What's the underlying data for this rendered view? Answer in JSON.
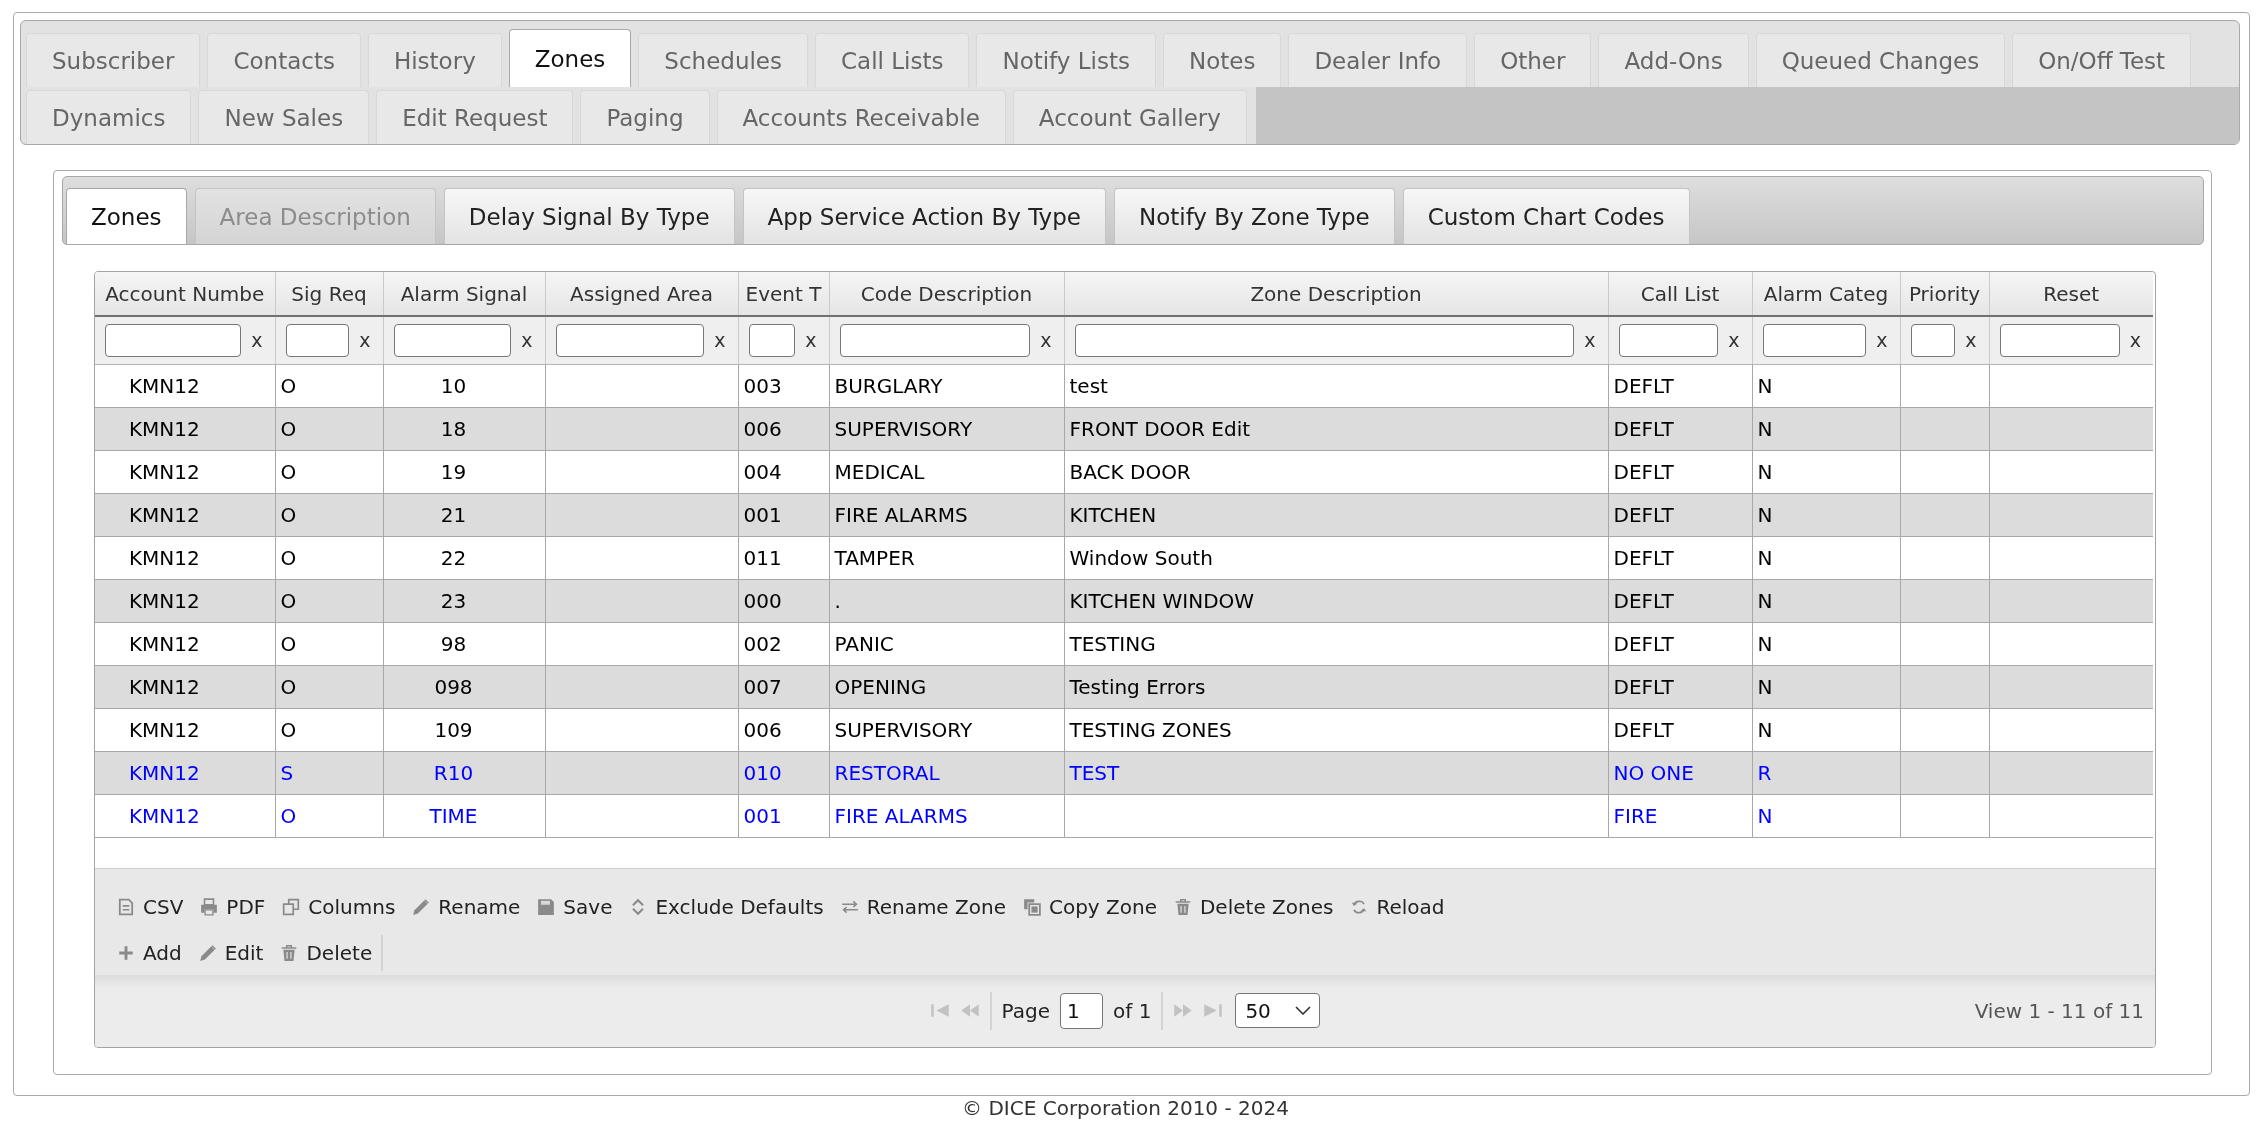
{
  "main_tab_rows": [
    [
      {
        "label": "Subscriber",
        "selected": false
      },
      {
        "label": "Contacts",
        "selected": false
      },
      {
        "label": "History",
        "selected": false
      },
      {
        "label": "Zones",
        "selected": true
      },
      {
        "label": "Schedules",
        "selected": false
      },
      {
        "label": "Call Lists",
        "selected": false
      },
      {
        "label": "Notify Lists",
        "selected": false
      },
      {
        "label": "Notes",
        "selected": false
      },
      {
        "label": "Dealer Info",
        "selected": false
      },
      {
        "label": "Other",
        "selected": false
      },
      {
        "label": "Add-Ons",
        "selected": false
      },
      {
        "label": "Queued Changes",
        "selected": false
      },
      {
        "label": "On/Off Test",
        "selected": false
      }
    ],
    [
      {
        "label": "Dynamics",
        "selected": false
      },
      {
        "label": "New Sales",
        "selected": false
      },
      {
        "label": "Edit Request",
        "selected": false
      },
      {
        "label": "Paging",
        "selected": false
      },
      {
        "label": "Accounts Receivable",
        "selected": false
      },
      {
        "label": "Account Gallery",
        "selected": false
      }
    ]
  ],
  "sub_tabs": [
    {
      "label": "Zones",
      "selected": true,
      "disabled": false
    },
    {
      "label": "Area Description",
      "selected": false,
      "disabled": true
    },
    {
      "label": "Delay Signal By Type",
      "selected": false,
      "disabled": false
    },
    {
      "label": "App Service Action By Type",
      "selected": false,
      "disabled": false
    },
    {
      "label": "Notify By Zone Type",
      "selected": false,
      "disabled": false
    },
    {
      "label": "Custom Chart Codes",
      "selected": false,
      "disabled": false
    }
  ],
  "grid": {
    "columns": [
      "Account Numbe",
      "Sig Req",
      "Alarm Signal",
      "Assigned Area",
      "Event T",
      "Code Description",
      "Zone Description",
      "Call List",
      "Alarm Categ",
      "Priority",
      "Reset"
    ],
    "filters": [
      {
        "clear": "x"
      },
      {
        "clear": "x"
      },
      {
        "clear": "x"
      },
      {
        "clear": "x"
      },
      {
        "clear": "x"
      },
      {
        "clear": "x"
      },
      {
        "clear": "x"
      },
      {
        "clear": "x"
      },
      {
        "clear": "x"
      },
      {
        "clear": "x"
      },
      {
        "clear": "x"
      }
    ],
    "rows": [
      {
        "account": "KMN12",
        "sig_req": "O",
        "alarm_signal": "10",
        "event_t": "003",
        "code_description": "BURGLARY",
        "zone_description": "test",
        "call_list": "DEFLT",
        "alarm_categ": "N",
        "color": "#000000"
      },
      {
        "account": "KMN12",
        "sig_req": "O",
        "alarm_signal": "18",
        "event_t": "006",
        "code_description": "SUPERVISORY",
        "zone_description": "FRONT DOOR Edit",
        "call_list": "DEFLT",
        "alarm_categ": "N",
        "color": "#000000"
      },
      {
        "account": "KMN12",
        "sig_req": "O",
        "alarm_signal": "19",
        "event_t": "004",
        "code_description": "MEDICAL",
        "zone_description": "BACK DOOR",
        "call_list": "DEFLT",
        "alarm_categ": "N",
        "color": "#000000"
      },
      {
        "account": "KMN12",
        "sig_req": "O",
        "alarm_signal": "21",
        "event_t": "001",
        "code_description": "FIRE ALARMS",
        "zone_description": "KITCHEN",
        "call_list": "DEFLT",
        "alarm_categ": "N",
        "color": "#000000"
      },
      {
        "account": "KMN12",
        "sig_req": "O",
        "alarm_signal": "22",
        "event_t": "011",
        "code_description": "TAMPER",
        "zone_description": "Window South",
        "call_list": "DEFLT",
        "alarm_categ": "N",
        "color": "#000000"
      },
      {
        "account": "KMN12",
        "sig_req": "O",
        "alarm_signal": "23",
        "event_t": "000",
        "code_description": ".",
        "zone_description": "KITCHEN WINDOW",
        "call_list": "DEFLT",
        "alarm_categ": "N",
        "color": "#000000"
      },
      {
        "account": "KMN12",
        "sig_req": "O",
        "alarm_signal": "98",
        "event_t": "002",
        "code_description": "PANIC",
        "zone_description": "TESTING",
        "call_list": "DEFLT",
        "alarm_categ": "N",
        "color": "#000000"
      },
      {
        "account": "KMN12",
        "sig_req": "O",
        "alarm_signal": "098",
        "event_t": "007",
        "code_description": "OPENING",
        "zone_description": "Testing Errors",
        "call_list": "DEFLT",
        "alarm_categ": "N",
        "color": "#000000"
      },
      {
        "account": "KMN12",
        "sig_req": "O",
        "alarm_signal": "109",
        "event_t": "006",
        "code_description": "SUPERVISORY",
        "zone_description": "TESTING ZONES",
        "call_list": "DEFLT",
        "alarm_categ": "N",
        "color": "#000000"
      },
      {
        "account": "KMN12",
        "sig_req": "S",
        "alarm_signal": "R10",
        "event_t": "010",
        "code_description": "RESTORAL",
        "zone_description": "TEST",
        "call_list": "NO ONE",
        "alarm_categ": "R",
        "color": "#0000ff"
      },
      {
        "account": "KMN12",
        "sig_req": "O",
        "alarm_signal": "TIME",
        "event_t": "001",
        "code_description": "FIRE ALARMS",
        "call_list": "FIRE",
        "alarm_categ": "N",
        "color": "#0000ff"
      }
    ],
    "toolbar_rows": [
      {
        "separator": false,
        "items": [
          {
            "kind": "csv",
            "label": "CSV"
          },
          {
            "kind": "pdf",
            "label": "PDF"
          },
          {
            "kind": "columns",
            "label": "Columns"
          },
          {
            "kind": "rename",
            "label": "Rename"
          },
          {
            "kind": "save",
            "label": "Save"
          },
          {
            "kind": "exclude",
            "label": "Exclude Defaults"
          },
          {
            "kind": "rename_zone",
            "label": "Rename Zone"
          },
          {
            "kind": "copy",
            "label": "Copy Zone"
          },
          {
            "kind": "delete",
            "label": "Delete Zones"
          },
          {
            "kind": "reload",
            "label": "Reload"
          }
        ]
      },
      {
        "separator": true,
        "items": [
          {
            "kind": "add",
            "label": "Add"
          },
          {
            "kind": "edit",
            "label": "Edit"
          },
          {
            "kind": "delete",
            "label": "Delete"
          }
        ]
      }
    ],
    "pager": {
      "nav_disabled": true,
      "page_label": "Page",
      "page": "1",
      "total": "of 1",
      "page_size": "50",
      "summary": "View 1 - 11 of 11"
    }
  },
  "footer": "© DICE Corporation 2010 - 2024"
}
